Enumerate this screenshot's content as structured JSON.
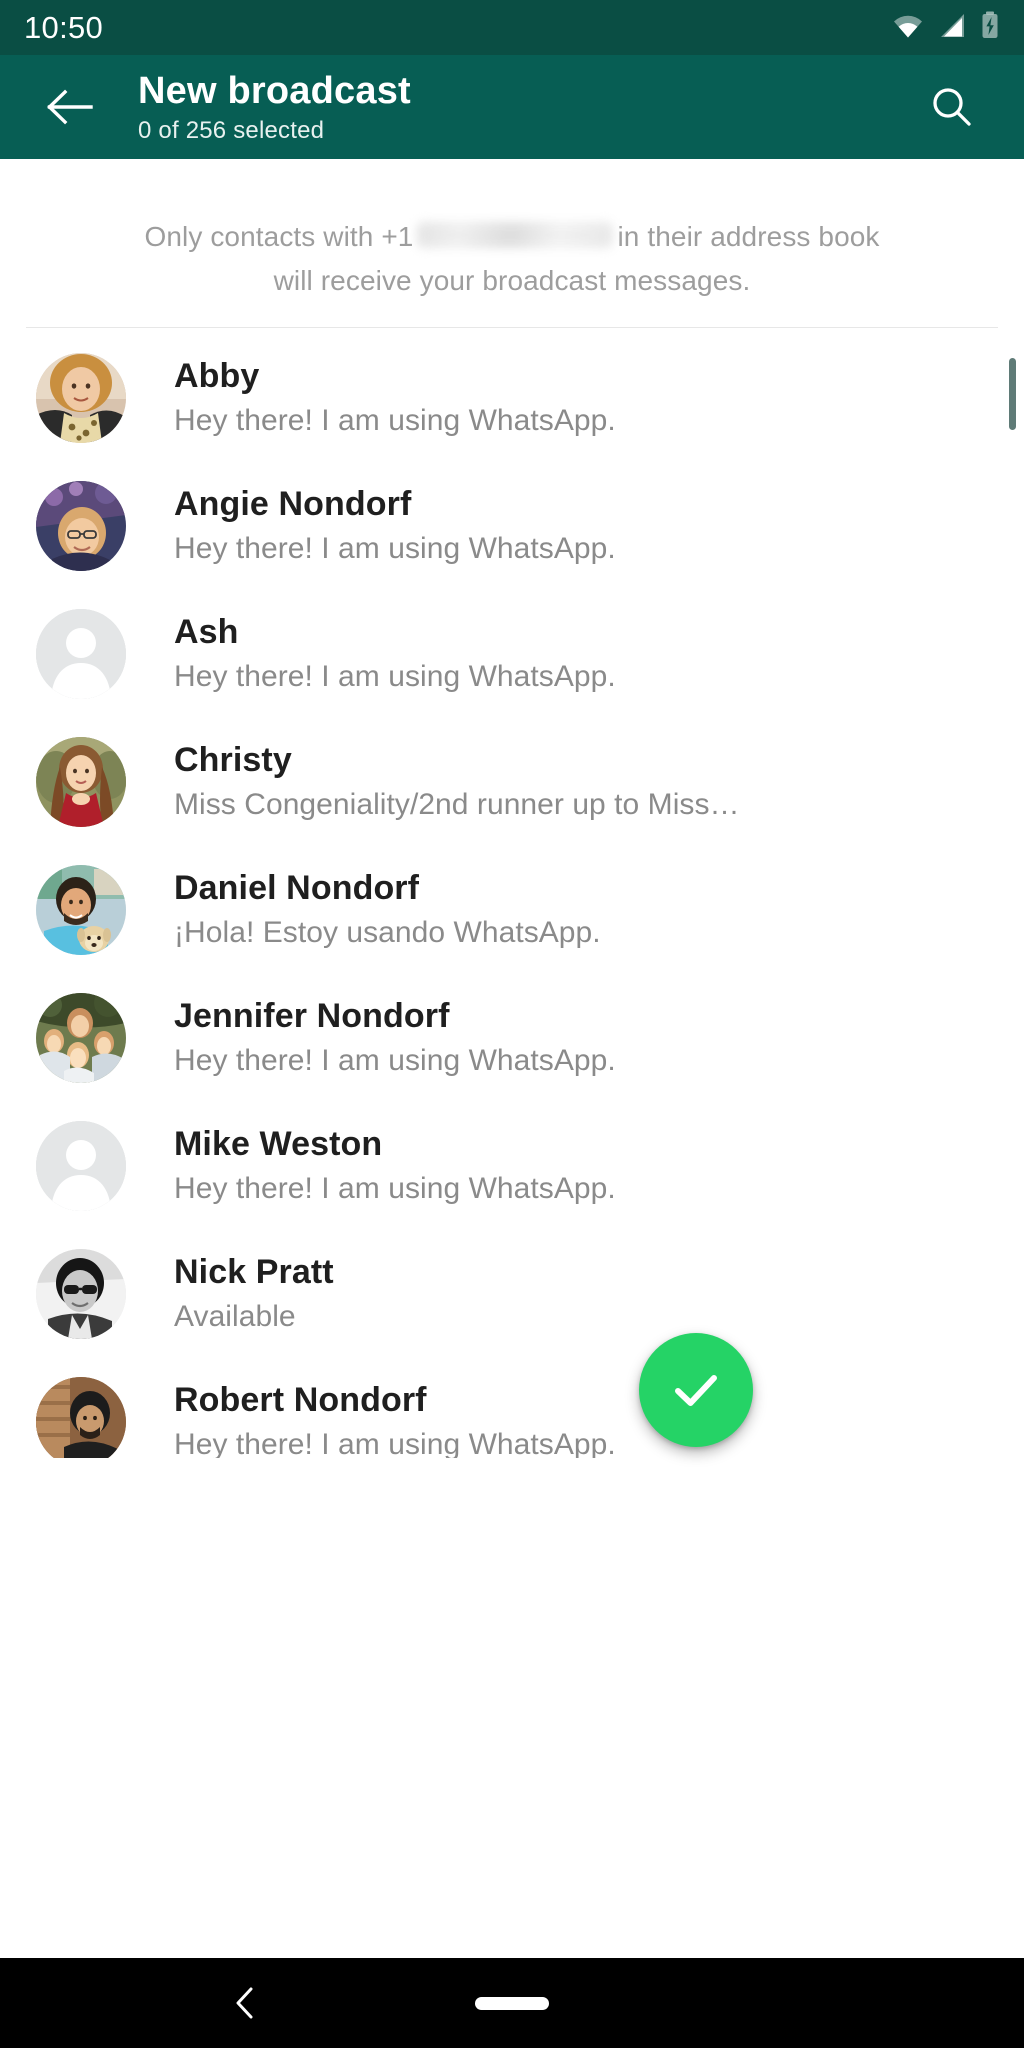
{
  "status_bar": {
    "time": "10:50",
    "icons": [
      "wifi-icon",
      "cell-signal-icon",
      "battery-charging-icon"
    ]
  },
  "app_bar": {
    "back_icon": "arrow-left-icon",
    "title": "New broadcast",
    "subtitle": "0 of 256 selected",
    "search_icon": "search-icon",
    "background_color": "#075E54"
  },
  "disclaimer": {
    "line1_before": "Only contacts with +1",
    "line1_redacted": "",
    "line1_after": "in their address book",
    "line2": "will receive your broadcast messages."
  },
  "contacts": [
    {
      "name": "Abby",
      "status": "Hey there! I am using WhatsApp.",
      "avatar_type": "photo"
    },
    {
      "name": "Angie Nondorf",
      "status": "Hey there! I am using WhatsApp.",
      "avatar_type": "photo"
    },
    {
      "name": "Ash",
      "status": "Hey there! I am using WhatsApp.",
      "avatar_type": "default"
    },
    {
      "name": "Christy",
      "status": "Miss Congeniality/2nd runner up to Miss…",
      "avatar_type": "photo"
    },
    {
      "name": "Daniel Nondorf",
      "status": "¡Hola! Estoy usando WhatsApp.",
      "avatar_type": "photo"
    },
    {
      "name": "Jennifer Nondorf",
      "status": "Hey there! I am using WhatsApp.",
      "avatar_type": "photo"
    },
    {
      "name": "Mike Weston",
      "status": "Hey there! I am using WhatsApp.",
      "avatar_type": "default"
    },
    {
      "name": "Nick Pratt",
      "status": "Available",
      "avatar_type": "photo"
    },
    {
      "name": "Robert Nondorf",
      "status": "Hey there! I am using WhatsApp.",
      "avatar_type": "photo"
    }
  ],
  "fab": {
    "icon": "check-icon",
    "color": "#25D366"
  },
  "nav_bar": {
    "back_icon": "nav-back-icon",
    "home_indicator": "home-pill-icon"
  }
}
